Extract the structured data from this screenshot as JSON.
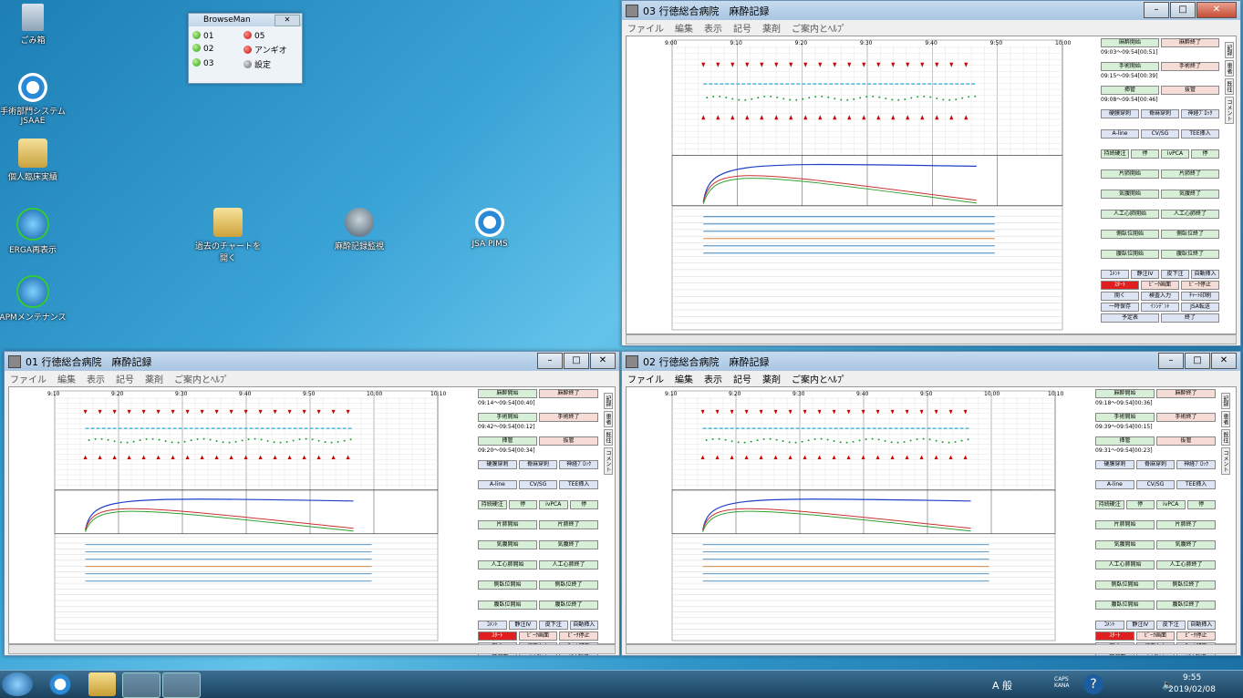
{
  "desktop": {
    "icons": [
      {
        "label": "ごみ箱"
      },
      {
        "label": "手術部門システム JSAAE"
      },
      {
        "label": "個人臨床実績"
      },
      {
        "label": "ERGA再表示"
      },
      {
        "label": "APMメンテナンス"
      },
      {
        "label": "過去のチャートを開く"
      },
      {
        "label": "麻酔記録監視"
      },
      {
        "label": "JSA PIMS"
      }
    ]
  },
  "browseman": {
    "title": "BrowseMan",
    "items": [
      "01",
      "05",
      "02",
      "アンギオ",
      "03",
      "設定"
    ]
  },
  "windows": [
    {
      "title": "03 行徳総合病院　麻酔記録",
      "menus": [
        "ファイル",
        "編集",
        "表示",
        "記号",
        "薬剤",
        "ご案内とﾍﾙﾌﾟ"
      ],
      "times": [
        "9:00",
        "9:10",
        "9:20",
        "9:30",
        "9:40",
        "9:50",
        "10:00"
      ],
      "times_rows": [
        "09:03〜09:54[00:51]",
        "09:15〜09:54[00:39]",
        "09:08〜09:54[00:46]"
      ]
    },
    {
      "title": "01 行徳総合病院　麻酔記録",
      "menus": [
        "ファイル",
        "編集",
        "表示",
        "記号",
        "薬剤",
        "ご案内とﾍﾙﾌﾟ"
      ],
      "times": [
        "9:10",
        "9:20",
        "9:30",
        "9:40",
        "9:50",
        "10:00",
        "10:10"
      ],
      "times_rows": [
        "09:14〜09:54[00:40]",
        "09:42〜09:54[00:12]",
        "09:20〜09:54[00:34]"
      ]
    },
    {
      "title": "02 行徳総合病院　麻酔記録",
      "menus": [
        "ファイル",
        "編集",
        "表示",
        "記号",
        "薬剤",
        "ご案内とﾍﾙﾌﾟ"
      ],
      "times": [
        "9:10",
        "9:20",
        "9:30",
        "9:40",
        "9:50",
        "10:00",
        "10:10"
      ],
      "times_rows": [
        "09:18〜09:54[00:36]",
        "09:39〜09:54[00:15]",
        "09:31〜09:54[00:23]"
      ]
    }
  ],
  "sidepanel_labels": {
    "row1": [
      "麻酔開始",
      "麻酔終了"
    ],
    "row2": [
      "手術開始",
      "手術終了"
    ],
    "row3": [
      "挿管",
      "抜管"
    ],
    "row4": [
      "硬膜穿刺",
      "脊麻穿刺",
      "神経ﾌﾞﾛｯｸ"
    ],
    "row5": [
      "A-line",
      "CV/SG",
      "TEE挿入"
    ],
    "row6": [
      "持続硬注",
      "停",
      "ivPCA",
      "停"
    ],
    "row7": [
      "片肺開始",
      "片肺終了"
    ],
    "row8": [
      "気腹開始",
      "気腹終了"
    ],
    "row9": [
      "人工心肺開始",
      "人工心肺終了"
    ],
    "row10": [
      "側臥位開始",
      "側臥位終了"
    ],
    "row11": [
      "腹臥位開始",
      "腹臥位終了"
    ],
    "row12": [
      "ｺﾒﾝﾄ",
      "静注IV",
      "皮下注",
      "自動挿入"
    ],
    "row13": [
      "ｽﾀｰﾄ",
      "ﾋﾞｰｸ画面",
      "ﾋﾞｰｸ停止"
    ],
    "row14": [
      "開く",
      "検査入力",
      "ﾁｬｰﾄ印刷"
    ],
    "row15": [
      "一時保存",
      "ｲﾝｼﾃﾞﾝﾄ",
      "JSA転送"
    ],
    "row16": [
      "予定表",
      "終了"
    ]
  },
  "vtabs": [
    "記録",
    "患者",
    "既往",
    "コメント"
  ],
  "taskbar": {
    "tray_text": "A 般",
    "caps": "CAPS KANA",
    "time": "9:55",
    "date": "2019/02/08"
  },
  "colors": {
    "accent": "#1f73b8",
    "hr_marker": "#cc0000",
    "spo2": "#27a8d6",
    "etco2": "#23a03a"
  }
}
